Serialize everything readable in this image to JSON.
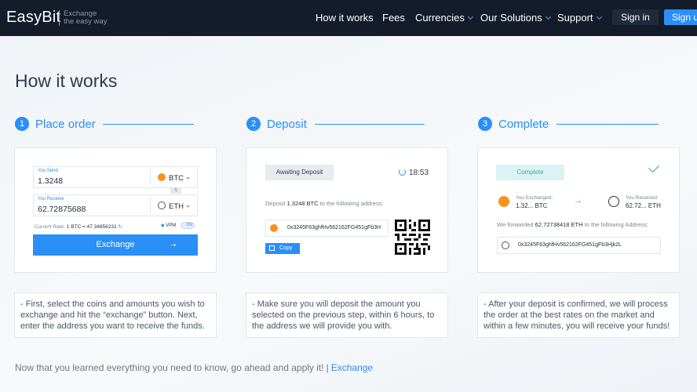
{
  "nav": {
    "logo": "EasyBit",
    "tagline_1": "Exchange",
    "tagline_2": "the easy way",
    "items": [
      "How it works",
      "Fees",
      "Currencies",
      "Our Solutions",
      "Support"
    ],
    "signin": "Sign in",
    "signup": "Sign up"
  },
  "page_title": "How it works",
  "steps": [
    {
      "num": "1",
      "label": "Place order",
      "note": "- First, select the coins and amounts you wish to exchange and hit the “exchange” button. Next, enter the address you want to receive the funds."
    },
    {
      "num": "2",
      "label": "Deposit",
      "note": "- Make sure you will deposit the amount you selected on the previous step, within 6 hours, to the address we will provide you with."
    },
    {
      "num": "3",
      "label": "Complete",
      "note": "- After your deposit is confirmed, we will process the order at the best rates on the market and within a few minutes, you will receive your funds!"
    }
  ],
  "order": {
    "send_label": "You Send",
    "send_value": "1.3248",
    "send_currency": "BTC",
    "receive_label": "You Receive",
    "receive_value": "62.72875688",
    "receive_currency": "ETH",
    "swap_icon": "swap-arrows",
    "rate_label": "Current Rate:",
    "rate_value": "1 BTC = 47.34856231",
    "vpm": "VPM",
    "toggle": "ON",
    "exchange_button": "Exchange"
  },
  "deposit": {
    "status": "Awaiting Deposit",
    "timer": "18:53",
    "line_prefix": "Deposit",
    "amount": "1.3248 BTC",
    "line_suffix": "to the following address:",
    "address": "0x3245F63ghfHv562162FG451gFb3H",
    "copy": "Copy"
  },
  "complete": {
    "status": "Complete",
    "exchanged_label": "You Exchanged:",
    "exchanged_value": "1.32... BTC",
    "received_label": "You Received:",
    "received_value": "62.72... ETH",
    "fwd_prefix": "We forwarded",
    "fwd_amount": "62.72738418 ETH",
    "fwd_suffix": "to the following Address:",
    "address": "0x3245F63ghfHv562162FG451gFb3Hjk2L"
  },
  "footer": {
    "text": "Now that you learned everything you need to know, go ahead and apply it!",
    "separator": "|",
    "link": "Exchange"
  },
  "colors": {
    "nav_bg": "#141c2b",
    "accent": "#2a8ff7",
    "btc": "#f7931a",
    "complete": "#3aa8a3"
  }
}
